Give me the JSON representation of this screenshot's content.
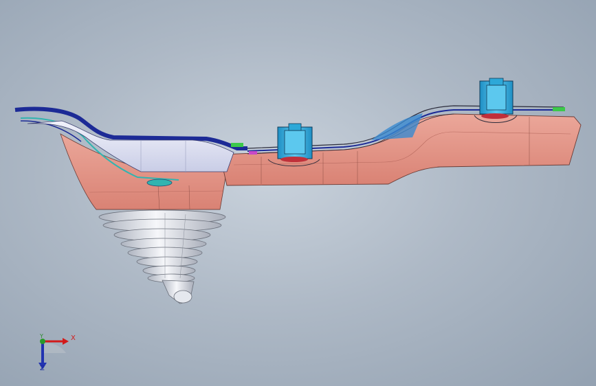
{
  "viewport": {
    "background_center": "#c9d2dc",
    "background_edge": "#93a1b1"
  },
  "model": {
    "colors": {
      "housing_pink": "#e79d90",
      "housing_shadow": "#d97f72",
      "cover_white": "#dfe3f4",
      "trim_blue": "#1c2a96",
      "trim_teal": "#32b4b0",
      "bracket_cyan": "#2da8d8",
      "bellows_white": "#eceef2",
      "bellows_shadow": "#b7bcc6",
      "edge_dark": "#2a2a3a",
      "accent_green": "#3cc84a",
      "accent_red": "#c0303a"
    }
  },
  "triad": {
    "x_label": "X",
    "y_label": "Y",
    "z_label": "Z",
    "x_icon": "arrow-right-icon",
    "y_icon": "dot-icon",
    "z_icon": "arrow-down-icon",
    "x_color": "#d21a1a",
    "y_color": "#2a9a2a",
    "z_color": "#2233b0"
  }
}
